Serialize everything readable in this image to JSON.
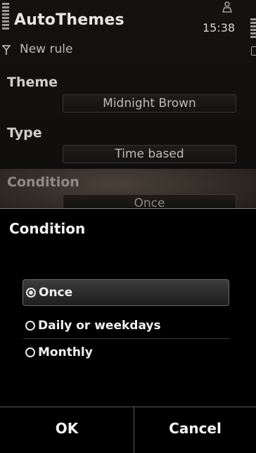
{
  "status": {
    "app_title": "AutoThemes",
    "time": "15:38",
    "icons": [
      "signal-icon",
      "battery-icon",
      "person-icon",
      "antenna-icon"
    ]
  },
  "page": {
    "subtitle": "New rule"
  },
  "settings": [
    {
      "label": "Theme",
      "value": "Midnight Brown"
    },
    {
      "label": "Type",
      "value": "Time based"
    },
    {
      "label": "Condition",
      "value": "Once"
    }
  ],
  "dialog": {
    "title": "Condition",
    "options": [
      {
        "label": "Once",
        "selected": true
      },
      {
        "label": "Daily or weekdays",
        "selected": false
      },
      {
        "label": "Monthly",
        "selected": false
      }
    ],
    "ok_label": "OK",
    "cancel_label": "Cancel"
  },
  "colors": {
    "background": "#000000",
    "highlight": "#4a4138",
    "text": "#ffffff"
  }
}
